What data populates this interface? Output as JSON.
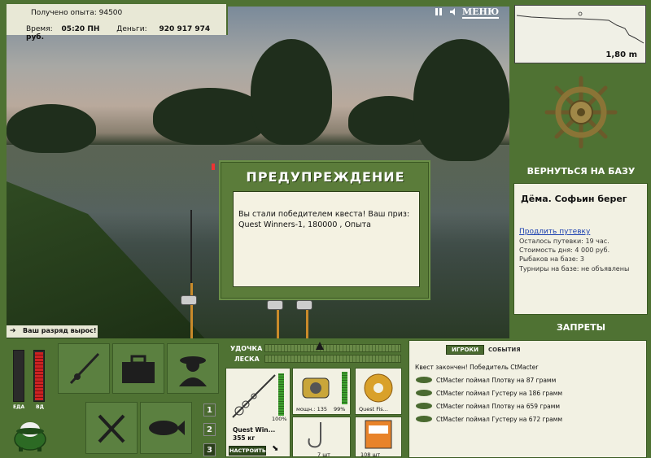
{
  "stats": {
    "experience_label": "Получено опыта:",
    "experience_value": "94500",
    "time_label": "Время:",
    "time_value": "05:20 ПН",
    "money_label": "Деньги:",
    "money_value": "920 917 974 руб."
  },
  "top_controls": {
    "pause_icon": "pause-icon",
    "sound_icon": "sound-icon",
    "menu_label": "МЕНЮ"
  },
  "depth": {
    "value": "1,80 m"
  },
  "base": {
    "return_label": "ВЕРНУТЬСЯ НА БАЗУ",
    "location": "Дёма. Софьин берег",
    "extend_link": "Продлить путевку",
    "lines": [
      "Осталось путевки: 19 час.",
      "Стоимость дня: 4 000 руб.",
      "Рыбаков на базе: 3",
      "Турниры на базе: не объявлены"
    ],
    "restrictions_label": "ЗАПРЕТЫ"
  },
  "dialog": {
    "title": "ПРЕДУПРЕЖДЕНИЕ",
    "message": "Вы стали победителем квеста! Ваш приз: Quest Winners-1, 180000 , Опыта"
  },
  "rank_notice": "Ваш разряд вырос!",
  "gauges": {
    "food_label": "ЕДА",
    "health_label": "ВД",
    "food_level": 0.0,
    "health_level": 0.95
  },
  "nav": {
    "buttons": [
      "1",
      "2",
      "3"
    ]
  },
  "rig": {
    "rod_label": "УДОЧКА",
    "line_label": "ЛЕСКА",
    "rod_name": "Quest Win...",
    "rod_weight": "355 кг",
    "rod_percent": "100%",
    "setup_label": "НАСТРОИТЬ",
    "reel_caption": "мощн.: 135",
    "reel_percent": "99%",
    "line_caption": "Quest Fis...",
    "hook_caption": "7 шт",
    "bait_caption": "108 шт"
  },
  "events": {
    "tab_players": "ИГРОКИ",
    "tab_events": "СОБЫТИЯ",
    "lines": [
      "Квест закончен! Победитель CtMacter",
      "CtMacter поймал Плотву на 87 грамм",
      "CtMacter поймал Густеру на 186 грамм",
      "CtMacter поймал Плотву на 659 грамм",
      "CtMacter поймал Густеру на 672 грамм"
    ]
  },
  "colors": {
    "panel_green": "#4f7233",
    "box_cream": "#f2f1e3",
    "link_blue": "#1a3fb0"
  }
}
